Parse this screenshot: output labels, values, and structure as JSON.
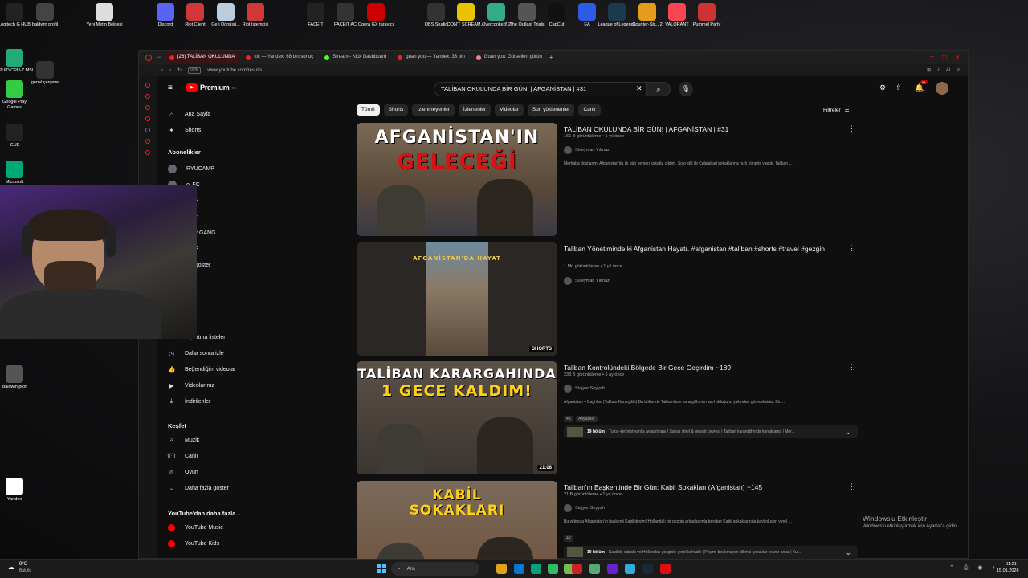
{
  "desktop": {
    "icons_top": [
      {
        "label": "Logitech G HUB",
        "color": "#222"
      },
      {
        "label": "baldwin profil",
        "color": "#444"
      },
      {
        "label": "Yeni Metin Belgesi",
        "color": "#ddd"
      },
      {
        "label": "Discord",
        "color": "#5865f2"
      },
      {
        "label": "Riot Client",
        "color": "#d13639"
      },
      {
        "label": "Geri Dönüşü...",
        "color": "#bcd"
      },
      {
        "label": "Riot İstemcisi",
        "color": "#d13639"
      },
      {
        "label": "FACEIT",
        "color": "#222"
      },
      {
        "label": "FACEIT AC",
        "color": "#333"
      },
      {
        "label": "Opera GX tarayıcı",
        "color": "#c00"
      },
      {
        "label": "OBS Studio",
        "color": "#333"
      },
      {
        "label": "DON'T SCREAM...",
        "color": "#e8c400"
      },
      {
        "label": "Overcooked! 2",
        "color": "#3a8"
      },
      {
        "label": "The Outlast Trials",
        "color": "#555"
      },
      {
        "label": "CapCut",
        "color": "#111"
      },
      {
        "label": "EA",
        "color": "#2d5be3"
      },
      {
        "label": "League of Legends",
        "color": "#1b3a4b"
      },
      {
        "label": "Counter-Str... 2",
        "color": "#e59b1b"
      },
      {
        "label": "VALORANT",
        "color": "#fa4454"
      },
      {
        "label": "Pummel Party",
        "color": "#c33"
      }
    ],
    "icons_left": [
      {
        "label": "CPUID CPU-Z MSI",
        "color": "#2a7"
      },
      {
        "label": "genel çerçeve",
        "color": "#333"
      },
      {
        "label": "Google Play Games",
        "color": "#3c4"
      },
      {
        "label": "iCUE",
        "color": "#222"
      },
      {
        "label": "Microsoft",
        "color": "#0a7"
      },
      {
        "label": "baldwin prof",
        "color": "#555"
      },
      {
        "label": "Yandex",
        "color": "#fff"
      }
    ],
    "activation": {
      "title": "Windows'u Etkinleştir",
      "sub": "Windows'u etkinleştirmek için Ayarlar'a gidin."
    }
  },
  "browser": {
    "tabs": [
      {
        "label": "(26) TALİBAN OKULUNDA",
        "active": true,
        "color": "#e22"
      },
      {
        "label": "kic — Yandex: 68 bin sonuç",
        "active": false,
        "color": "#e22"
      },
      {
        "label": "Stream - Kick Dashboard",
        "active": false,
        "color": "#53fc18"
      },
      {
        "label": "guan you — Yandex: 33 bin",
        "active": false,
        "color": "#e22"
      },
      {
        "label": "Guan you: Görselleri görün",
        "active": false,
        "color": "#e88"
      }
    ],
    "url": "www.youtube.com/results",
    "vpn": "VPN",
    "ai": "AI"
  },
  "youtube": {
    "logo": "Premium",
    "logo_sup": "TR",
    "search_value": "TALİBAN OKULUNDA BİR GÜN! | AFGANİSTAN | #31",
    "notif_count": "9+",
    "guide": {
      "main": [
        {
          "label": "Ana Sayfa",
          "icon": "⌂"
        },
        {
          "label": "Shorts",
          "icon": "✦"
        }
      ],
      "subs_header": "Abonelikler",
      "subs": [
        "RYUCAMP",
        "ol FC",
        "abak",
        "aray",
        "TER GANG",
        "OKE",
        "zla göster"
      ],
      "you": [
        {
          "label": "Oynatma listeleri",
          "icon": "≡"
        },
        {
          "label": "Daha sonra izle",
          "icon": "◷"
        },
        {
          "label": "Beğendiğim videolar",
          "icon": "👍"
        },
        {
          "label": "Videolarınız",
          "icon": "▶"
        },
        {
          "label": "İndirilenler",
          "icon": "⤓"
        }
      ],
      "explore_header": "Keşfet",
      "explore": [
        {
          "label": "Müzik",
          "icon": "♫"
        },
        {
          "label": "Canlı",
          "icon": "((·))"
        },
        {
          "label": "Oyun",
          "icon": "◎"
        },
        {
          "label": "Daha fazla göster",
          "icon": "⌄"
        }
      ],
      "more_header": "YouTube'dan daha fazla...",
      "more": [
        "YouTube Music",
        "YouTube Kids"
      ]
    },
    "chips": [
      "Tümü",
      "Shorts",
      "İzlenmeyenler",
      "İzlenenler",
      "Videolar",
      "Son yüklenenler",
      "Canlı"
    ],
    "filters": "Filtreler",
    "videos": [
      {
        "title": "TALİBAN OKULUNDA BİR GÜN! | AFGANİSTAN | #31",
        "meta": "166 B görüntüleme • 1 yıl önce",
        "channel": "Süleyman Yılmaz",
        "desc": "Merhaba dostlarım. Afganistan'da ilk gün hemen sokağa çıktım. Solo still ile Celalabad sokaklarına hızlı bir giriş yaptık. Taliban ...",
        "thumb_line1": "AFGANİSTAN'IN",
        "thumb_line2": "GELECEĞİ"
      },
      {
        "title": "Taliban Yönetiminde ki Afganistan Hayatı. #afganistan #taliban #shorts #travel #gezgin",
        "meta": "1 Mn görüntüleme • 1 yıl önce",
        "channel": "Süleyman Yılmaz",
        "badge": "SHORTS",
        "thumb_line1": "AFGANİSTAN'DA HAYAT"
      },
      {
        "title": "Taliban Kontrolündeki Bölgede Bir Gece Geçirdim ~189",
        "meta": "233 B görüntüleme • 5 ay önce",
        "channel": "Stajyer Seyyah",
        "desc": "Afganistan – Baghlan (Taliban Karargâhı) Bu bölümde Talibanların karargâhının nasıl olduğunu yakından göreceksiniz. Bir ...",
        "tags": [
          "4K",
          "Altyazılar"
        ],
        "chapters": "19 bölüm",
        "chapters_text": "Turist–terörist yanlış anlaşılması | Savaş izleri & mescit çevresi | Taliban karargâhında konaklama | Mer...",
        "duration": "21:08",
        "thumb_line1": "TALİBAN KARARGAHINDA",
        "thumb_line2": "1 GECE KALDIM!"
      },
      {
        "title": "Taliban'ın Başkentinde Bir Gün: Kabil Sokakları (Afganistan) ~145",
        "meta": "21 B görüntüleme • 1 yıl önce",
        "channel": "Stajyer Seyyah",
        "desc": "Bu videoda Afganistan'ın başkenti Kabil'deyim! Hollandalı bir gezgin arkadaşımla beraber Kabil sokaklarında kayboluyor, yerel ...",
        "tags": [
          "4K"
        ],
        "chapters": "10 bölüm",
        "chapters_text": "Kabil'de sabahı ve Hollandalı gezginle yerel kahvaltı | Peşimi bırakmayan dilenci çocuklar ve zor anlar | Ku...",
        "thumb_line1": "KABİL",
        "thumb_line2": "SOKAKLARI"
      }
    ]
  },
  "taskbar": {
    "weather_temp": "9°C",
    "weather_desc": "Bulutlu",
    "search_placeholder": "Ara",
    "time": "01:21",
    "date": "15.01.2026"
  }
}
